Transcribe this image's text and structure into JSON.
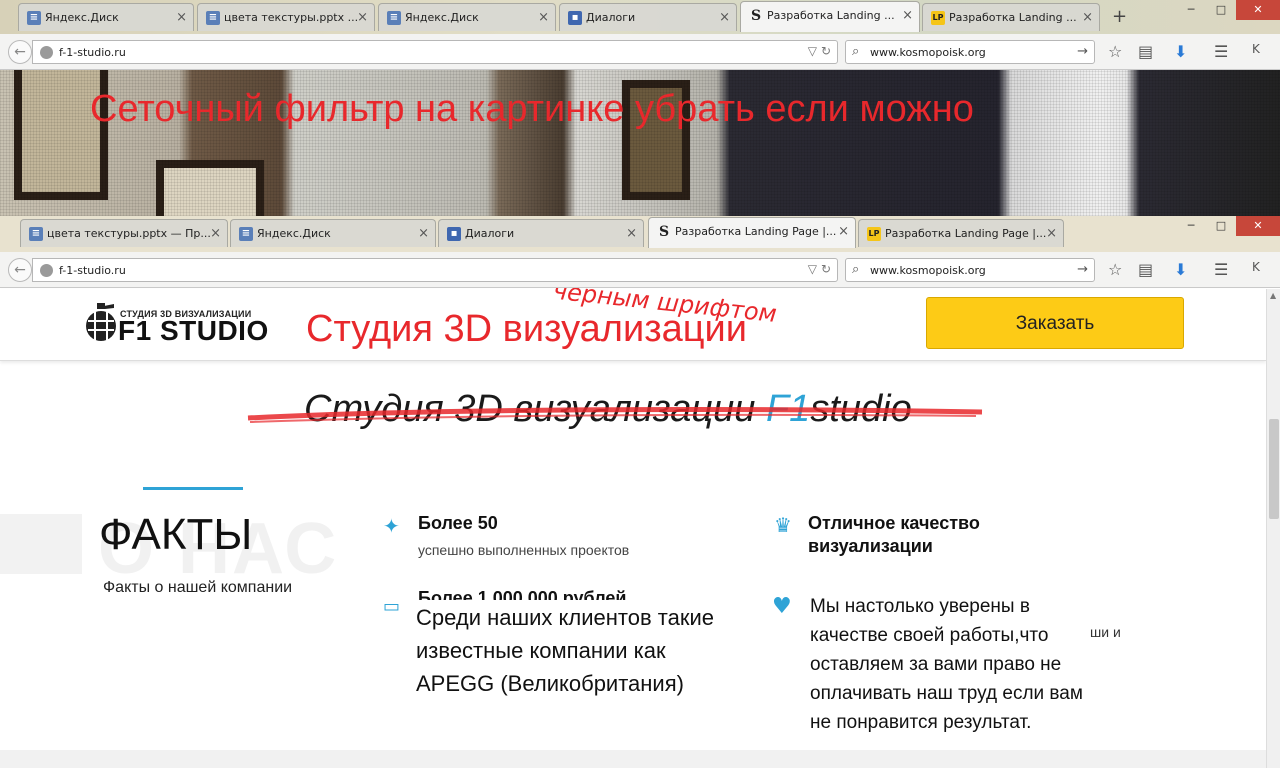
{
  "browser_top": {
    "tabs": [
      {
        "label": "Яндекс.Диск",
        "icon": "doc-icon"
      },
      {
        "label": "цвета текстуры.pptx ...",
        "icon": "doc-icon"
      },
      {
        "label": "Яндекс.Диск",
        "icon": "doc-icon"
      },
      {
        "label": "Диалоги",
        "icon": "dialog-icon"
      },
      {
        "label": "Разработка Landing ...",
        "icon": "s-icon"
      },
      {
        "label": "Разработка Landing ...",
        "icon": "lp-icon"
      }
    ],
    "url": "f-1-studio.ru",
    "search": "www.kosmopoisk.org"
  },
  "banner_note": "Сеточный фильтр на картинке убрать если можно",
  "browser_bottom": {
    "tabs": [
      {
        "label": "цвета текстуры.pptx — Пр...",
        "icon": "doc-icon"
      },
      {
        "label": "Яндекс.Диск",
        "icon": "doc-icon"
      },
      {
        "label": "Диалоги",
        "icon": "dialog-icon"
      },
      {
        "label": "Разработка Landing Page |...",
        "icon": "s-icon"
      },
      {
        "label": "Разработка Landing Page |...",
        "icon": "lp-icon"
      }
    ],
    "url": "f-1-studio.ru",
    "search": "www.kosmopoisk.org"
  },
  "site": {
    "logo_small": "СТУДИЯ 3D ВИЗУАЛИЗАЦИИ",
    "logo_big": "F1 STUDIO",
    "header_note": "Студия 3D визуализации",
    "handwritten_note": "черным шрифтом",
    "order_button": "Заказать",
    "slogan_prefix": "Студия 3D визуализации ",
    "slogan_brand1": "F1",
    "slogan_brand2": "studio",
    "watermark": "О НАС",
    "facts_title": "ФАКТЫ",
    "facts_subtitle": "Факты о нашей компании",
    "feature1_title": "Более 50",
    "feature1_desc": "успешно выполненных проектов",
    "feature2_title_partial": "Более 1 000 000 рублей",
    "feature3_title": "Отличное качество визуализации",
    "feature4_partial": "ши и",
    "overlay_clients": "Среди наших клиентов такие известные компании как APEGG (Великобритания)",
    "overlay_guarantee": "Мы настолько уверены в качестве своей работы,что оставляем за вами право не оплачивать наш труд если вам не понравится результат."
  },
  "colors": {
    "accent": "#2ea3d6",
    "button": "#fdcb16",
    "annotation_red": "#e8282c"
  }
}
